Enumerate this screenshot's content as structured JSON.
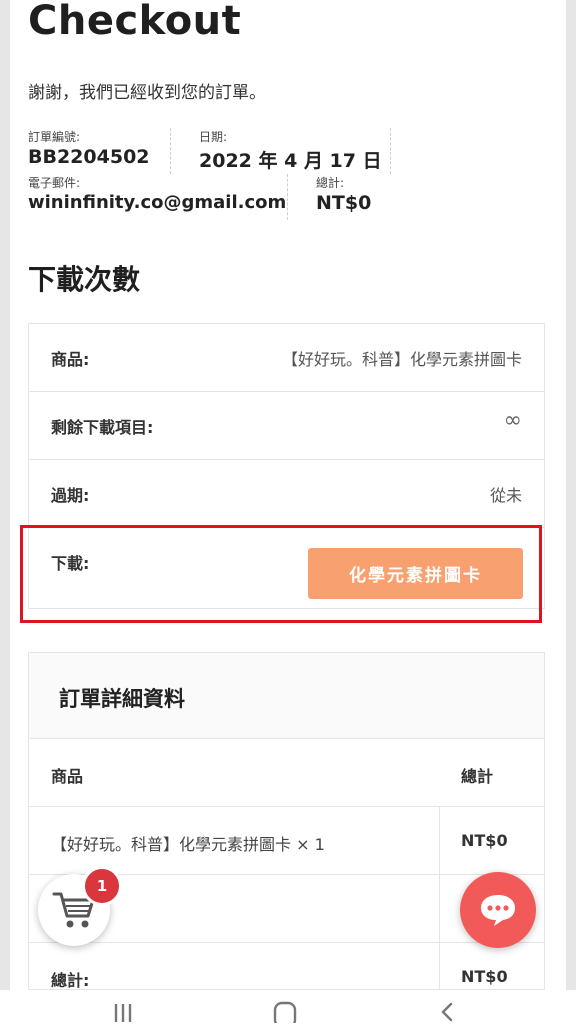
{
  "page": {
    "title": "Checkout",
    "thanks": "謝謝，我們已經收到您的訂單。"
  },
  "order_meta": {
    "order_number_label": "訂單編號:",
    "order_number": "BB2204502",
    "date_label": "日期:",
    "date": "2022 年 4 月 17 日",
    "email_label": "電子郵件:",
    "email": "wininfinity.co@gmail.com",
    "total_label": "總計:",
    "total": "NT$0"
  },
  "downloads": {
    "title": "下載次數",
    "rows": [
      {
        "label": "商品:",
        "value": "【好好玩。科普】化學元素拼圖卡"
      },
      {
        "label": "剩餘下載項目:",
        "value": "∞"
      },
      {
        "label": "過期:",
        "value": "從未"
      },
      {
        "label": "下載:",
        "button": "化學元素拼圖卡"
      }
    ]
  },
  "order_details": {
    "title": "訂單詳細資料",
    "header_product": "商品",
    "header_total": "總計",
    "item_name": "【好好玩。科普】化學元素拼圖卡 × 1",
    "item_total": "NT$0",
    "subtotal_label": "",
    "subtotal_value": "",
    "total_label": "總計:",
    "total_value": "NT$0"
  },
  "cart": {
    "badge_count": "1",
    "icon": "shopping-cart-icon"
  },
  "chat": {
    "icon": "chat-bubble-icon"
  },
  "colors": {
    "download_button": "#f9a071",
    "highlight": "#e0141e",
    "chat_button": "#f25a5a",
    "badge": "#d9363e"
  },
  "navbar": {
    "recent_icon": "recent-apps-icon",
    "home_icon": "home-icon",
    "back_icon": "back-icon"
  }
}
